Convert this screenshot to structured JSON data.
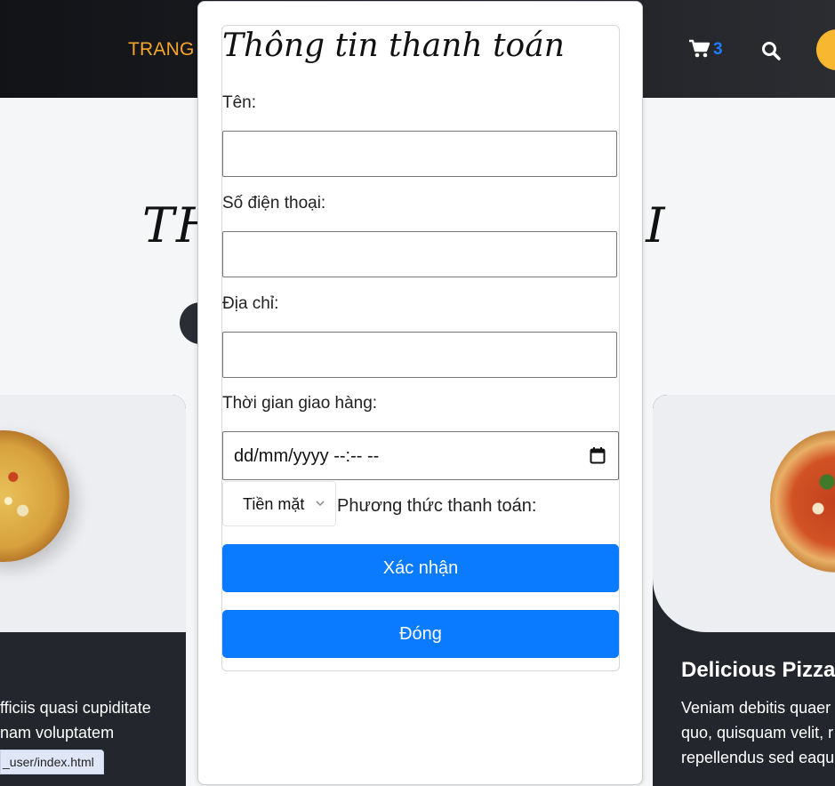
{
  "navbar": {
    "nav_link": "TRANG C",
    "cart_count": "3"
  },
  "background": {
    "section_title_left": "TH",
    "section_title_right": "ÔI",
    "left_card": {
      "lines": [
        "fficiis quasi cupiditate",
        "nam voluptatem"
      ]
    },
    "right_card": {
      "heading": "Delicious Pizza",
      "lines": [
        "Veniam debitis quaer",
        "quo, quisquam velit, r",
        "repellendus sed eaqu"
      ]
    },
    "status_url": "_user/index.html"
  },
  "modal": {
    "title": "Thông tin thanh toán",
    "name_label": "Tên:",
    "phone_label": "Số điện thoại:",
    "address_label": "Địa chỉ:",
    "delivery_time_label": "Thời gian giao hàng:",
    "datetime_placeholder": "dd/mm/yyyy  --:-- --",
    "payment_select_value": "Tiền mặt",
    "payment_method_label": "Phương thức thanh toán:",
    "confirm_button": "Xác nhận",
    "close_button": "Đóng"
  },
  "colors": {
    "accent_blue": "#0a7bff",
    "nav_link_orange": "#f7a52a",
    "user_yellow": "#f7b731"
  }
}
